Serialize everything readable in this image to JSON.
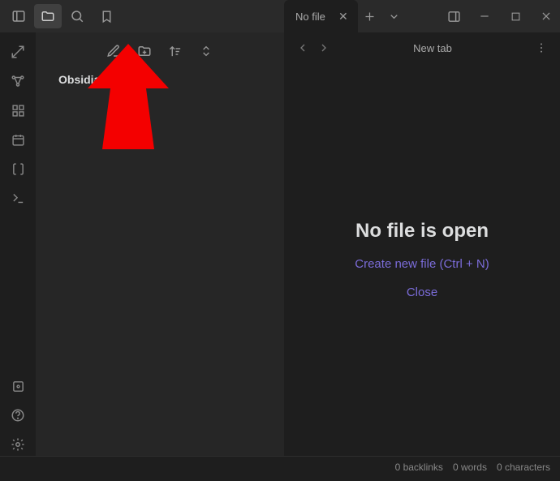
{
  "tabs": {
    "active_label": "No file"
  },
  "view": {
    "title": "New tab"
  },
  "vault": {
    "name": "Obsidian Vault"
  },
  "empty": {
    "heading": "No file is open",
    "create_label": "Create new file (Ctrl + N)",
    "close_label": "Close"
  },
  "status": {
    "backlinks": "0 backlinks",
    "words": "0 words",
    "characters": "0 characters"
  }
}
